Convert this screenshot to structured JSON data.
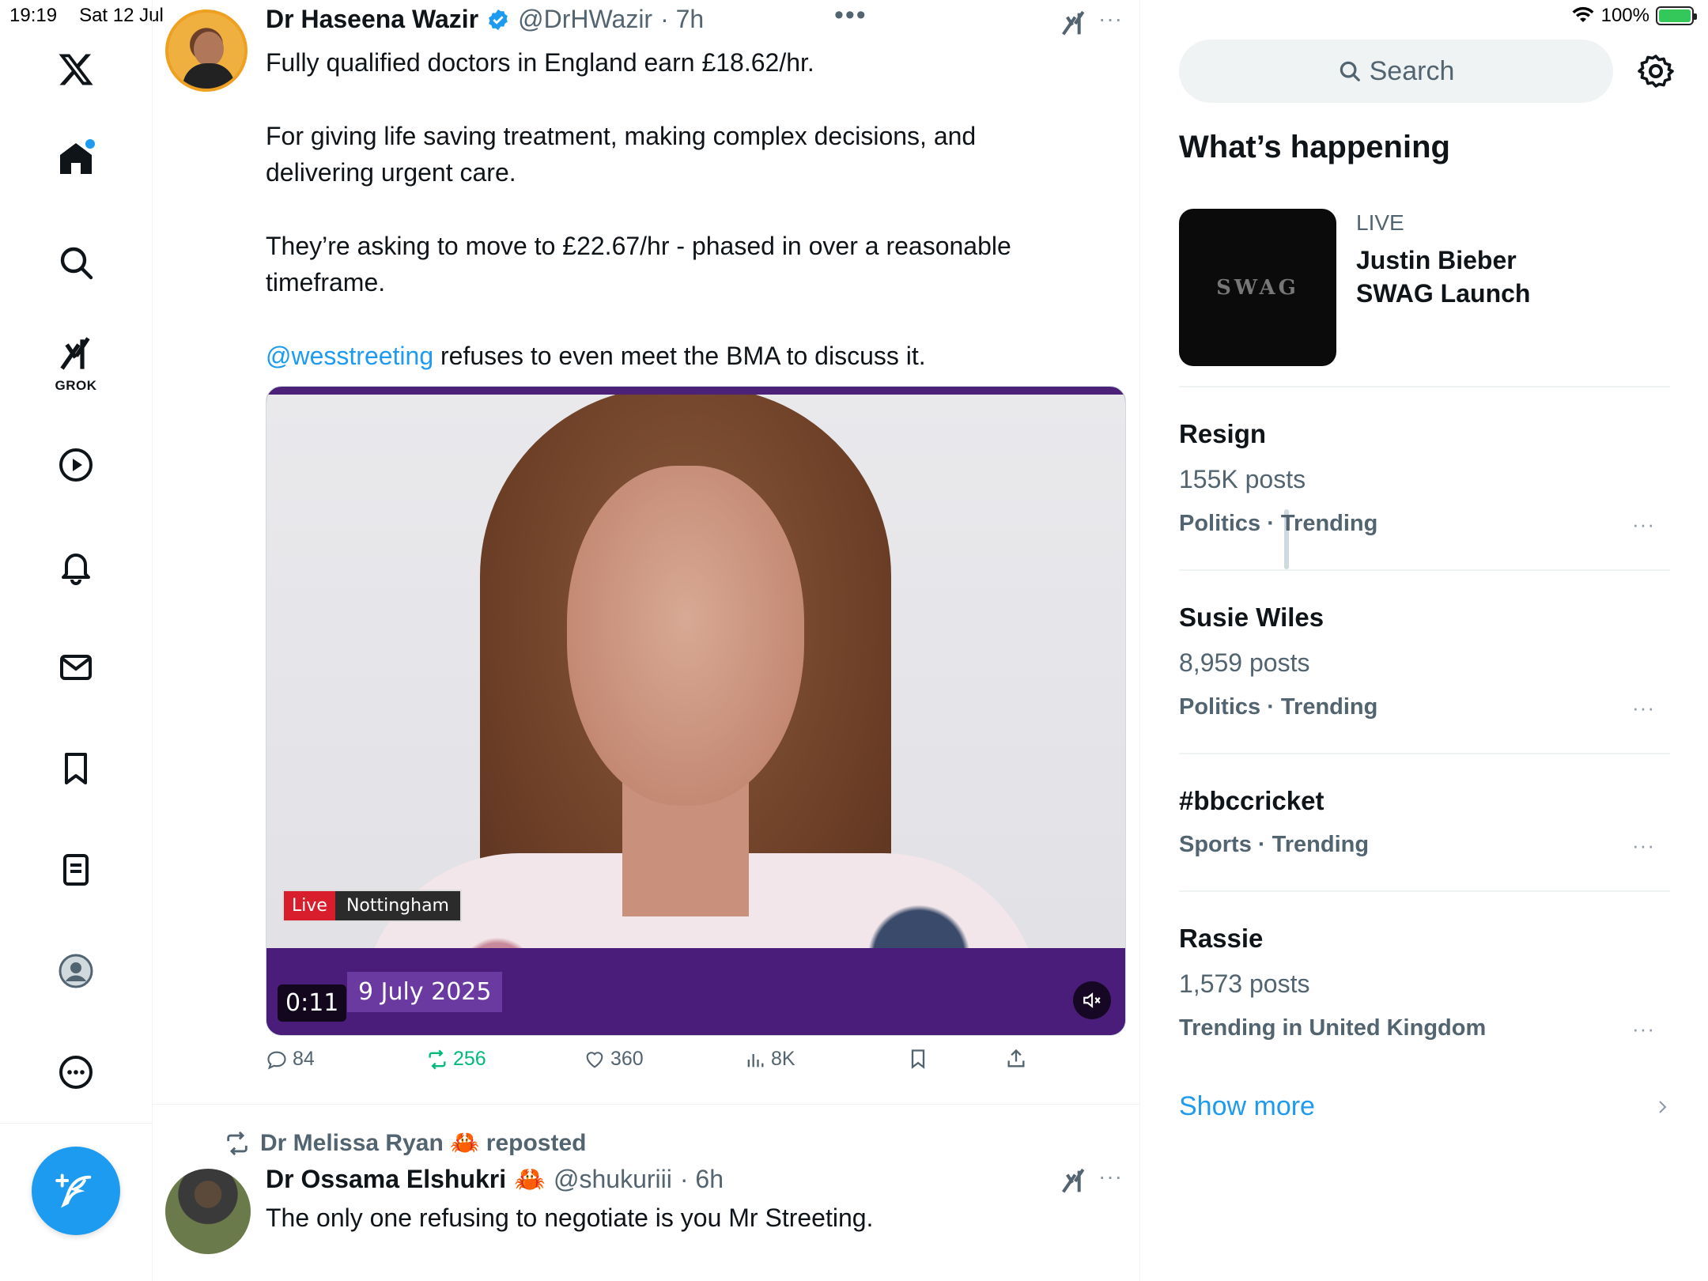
{
  "status_bar": {
    "time": "19:19",
    "date": "Sat 12 Jul",
    "battery": "100%"
  },
  "nav": {
    "grok_label": "GROK"
  },
  "tweet1": {
    "name": "Dr Haseena Wazir",
    "handle": "@DrHWazir",
    "time": "· 7h",
    "paragraphs": [
      "Fully qualified doctors in England earn £18.62/hr.",
      "For giving life saving treatment, making complex decisions, and delivering urgent care.",
      "They’re asking to move to £22.67/hr - phased in over a reasonable timeframe."
    ],
    "mention": "@wesstreeting",
    "mention_rest": " refuses to even meet the BMA to discuss it.",
    "video": {
      "live_label": "Live",
      "location": "Nottingham",
      "date": "9 July 2025",
      "timestamp": "0:11"
    },
    "stats": {
      "replies": "84",
      "reposts": "256",
      "likes": "360",
      "views": "8K"
    }
  },
  "tweet2": {
    "reposted_by": "Dr Melissa Ryan 🦀 reposted",
    "name": "Dr Ossama Elshukri",
    "emoji": "🦀",
    "handle": "@shukuriii",
    "time": "· 6h",
    "text": "The only one refusing to negotiate is you Mr Streeting."
  },
  "sidebar": {
    "search_placeholder": "Search",
    "whats_happening": "What’s happening",
    "live": {
      "label": "LIVE",
      "title": "Justin Bieber SWAG Launch",
      "thumb_text": "SWAG"
    },
    "trends": [
      {
        "name": "Resign",
        "posts": "155K posts",
        "category": "Politics · Trending"
      },
      {
        "name": "Susie Wiles",
        "posts": "8,959 posts",
        "category": "Politics · Trending"
      },
      {
        "name": "#bbccricket",
        "posts": "",
        "category": "Sports · Trending"
      },
      {
        "name": "Rassie",
        "posts": "1,573 posts",
        "category": "Trending in United Kingdom"
      }
    ],
    "show_more": "Show more"
  },
  "colors": {
    "accent": "#1d9bf0",
    "repost_green": "#00ba7c",
    "muted": "#536471"
  }
}
